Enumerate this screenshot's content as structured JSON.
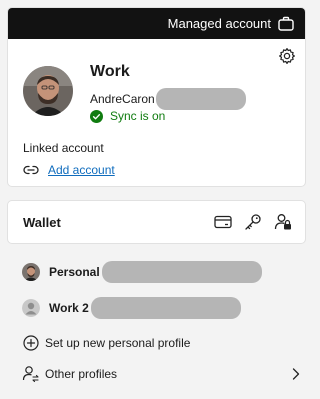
{
  "header": {
    "managed_label": "Managed account"
  },
  "profile": {
    "name": "Work",
    "email_prefix": "AndreCaron",
    "sync_status": "Sync is on",
    "linked_label": "Linked account",
    "add_account_label": "Add account"
  },
  "wallet": {
    "title": "Wallet"
  },
  "profiles": [
    {
      "name": "Personal"
    },
    {
      "name": "Work 2"
    }
  ],
  "actions": {
    "setup_new": "Set up new personal profile",
    "other_profiles": "Other profiles"
  },
  "colors": {
    "sync_green": "#107c10",
    "link_blue": "#0f6cbd",
    "bar_black": "#121212"
  }
}
